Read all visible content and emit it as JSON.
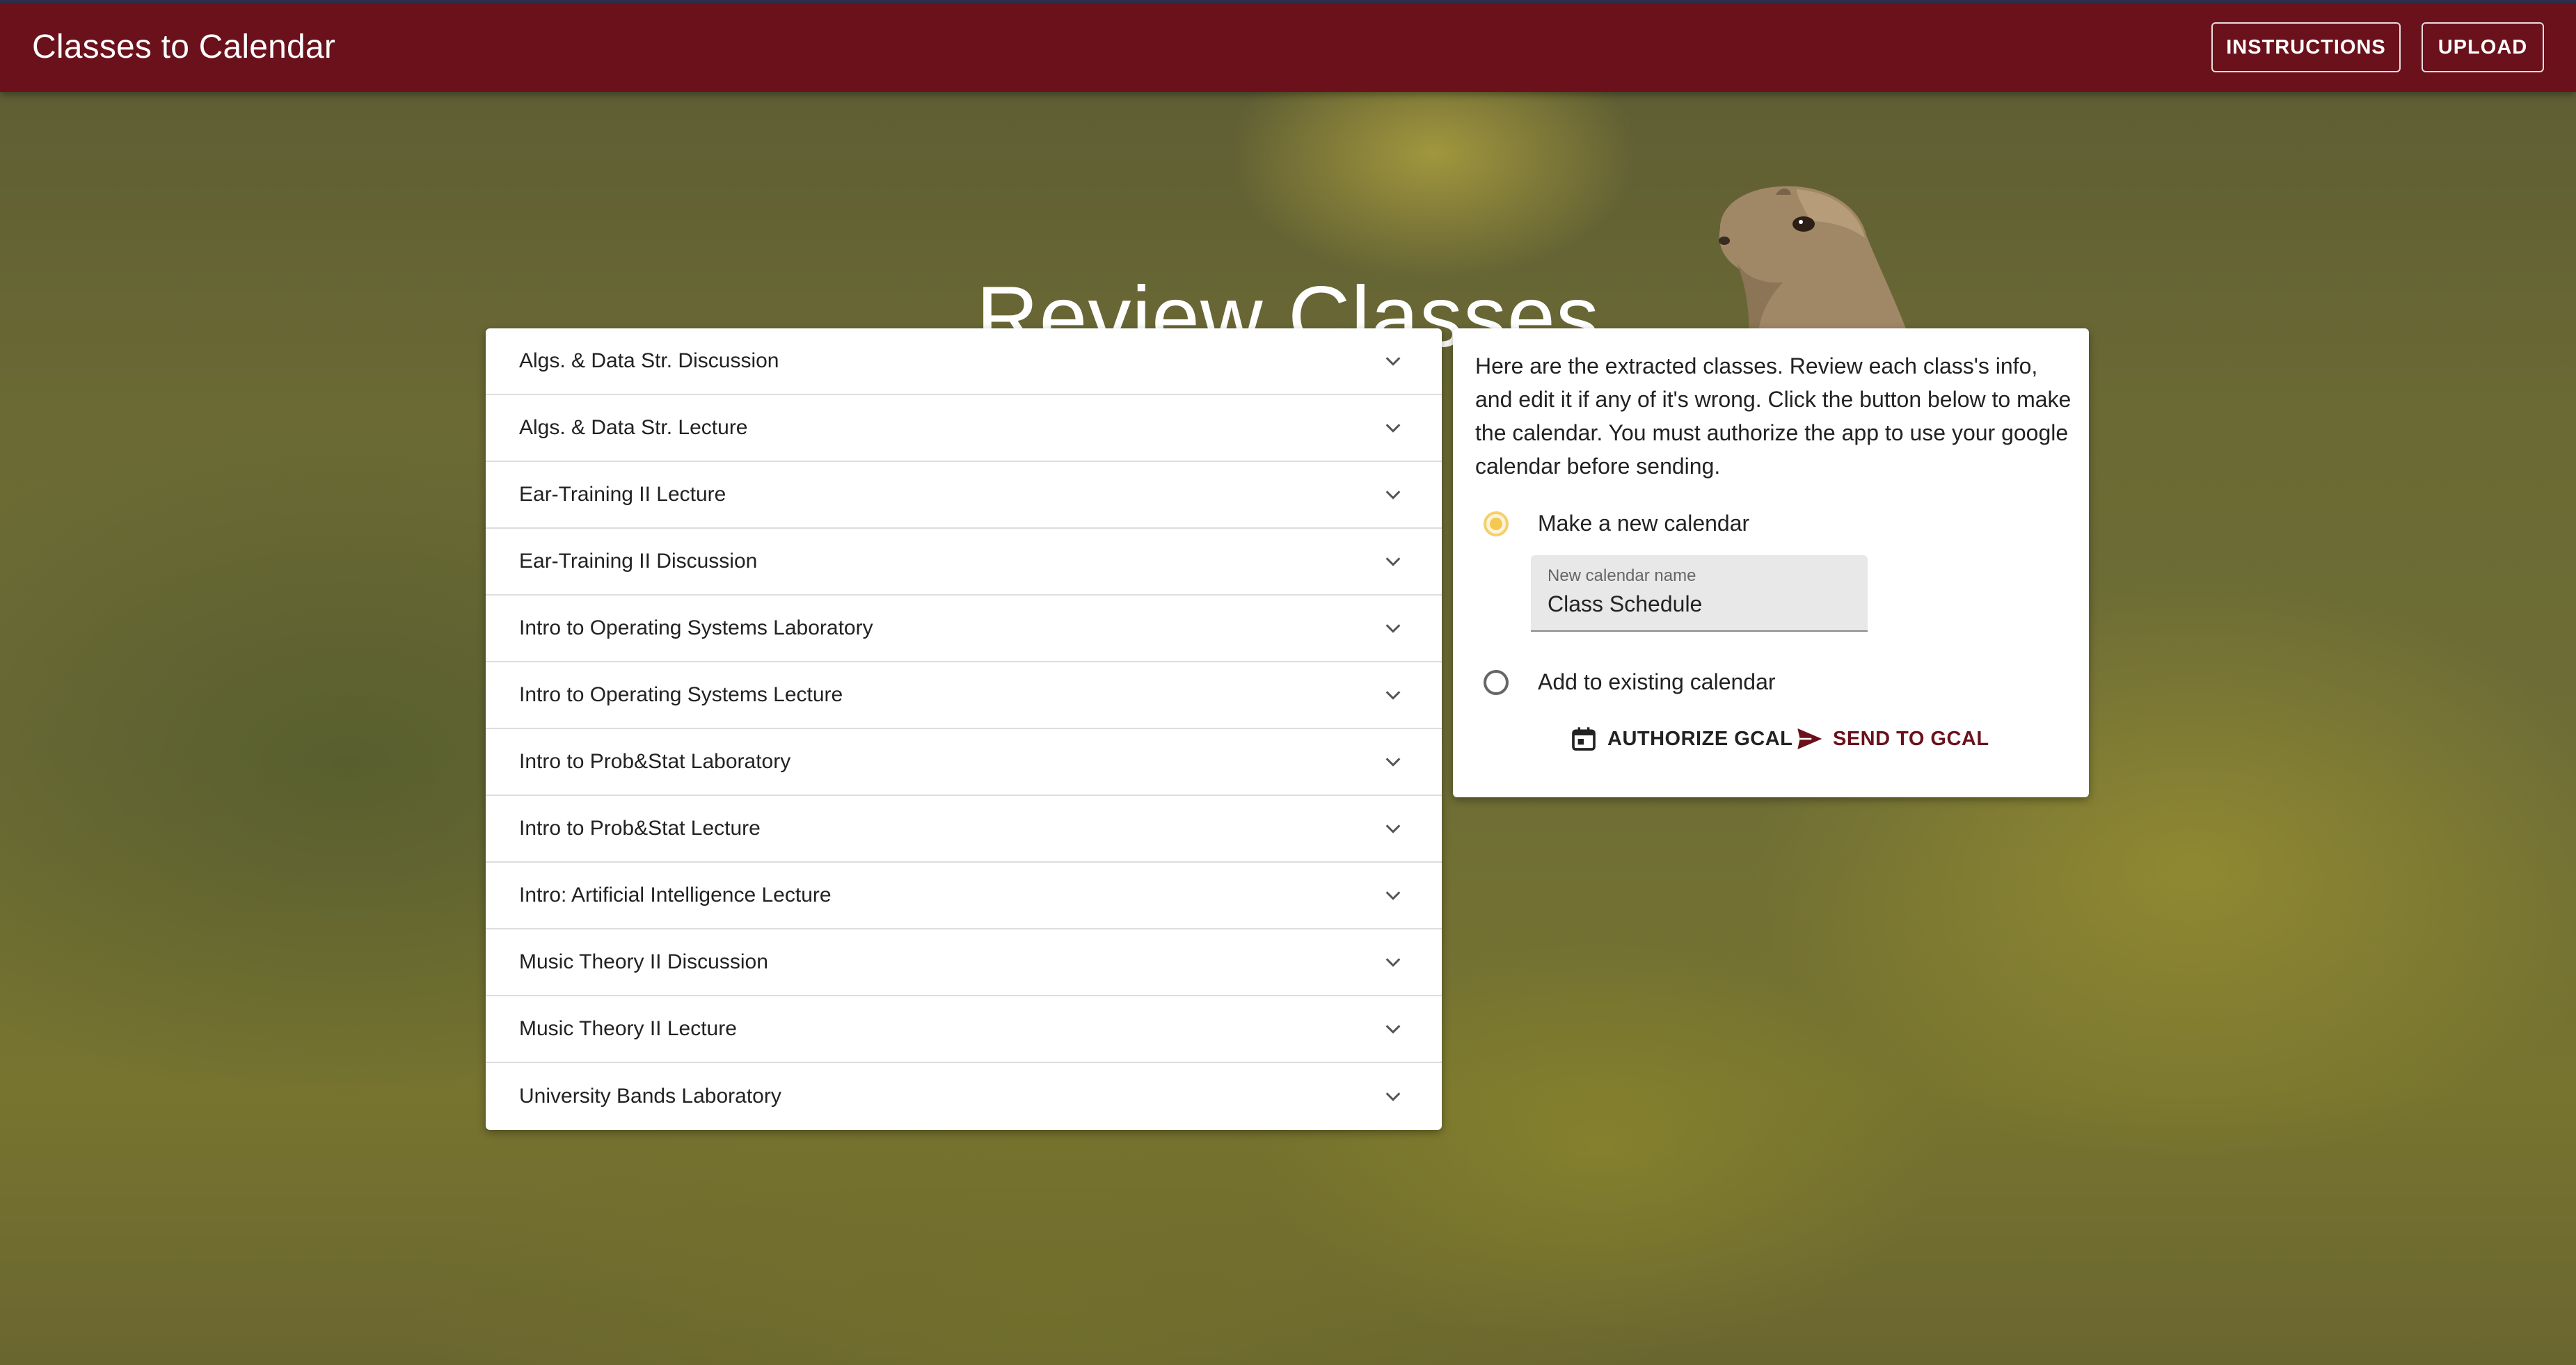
{
  "appbar": {
    "title": "Classes to Calendar",
    "instructions_label": "INSTRUCTIONS",
    "upload_label": "UPLOAD"
  },
  "page": {
    "heading": "Review Classes"
  },
  "classes": [
    "Algs. & Data Str. Discussion",
    "Algs. & Data Str. Lecture",
    "Ear-Training II Lecture",
    "Ear-Training II Discussion",
    "Intro to Operating Systems Laboratory",
    "Intro to Operating Systems Lecture",
    "Intro to Prob&Stat Laboratory",
    "Intro to Prob&Stat Lecture",
    "Intro: Artificial Intelligence Lecture",
    "Music Theory II Discussion",
    "Music Theory II Lecture",
    "University Bands Laboratory"
  ],
  "panel": {
    "instructions": "Here are the extracted classes. Review each class's info, and edit it if any of it's wrong. Click the button below to make the calendar. You must authorize the app to use your google calendar before sending.",
    "option_new": "Make a new calendar",
    "option_existing": "Add to existing calendar",
    "selected_option": "Make a new calendar",
    "new_calendar_field": {
      "label": "New calendar name",
      "value": "Class Schedule"
    },
    "authorize_label": "AUTHORIZE GCAL",
    "send_label": "SEND TO GCAL"
  },
  "colors": {
    "brand": "#6a111c",
    "radio_selected": "#f5c94f"
  },
  "icons": {
    "chevron": "chevron-down-icon",
    "authorize": "calendar-icon",
    "send": "send-icon"
  }
}
